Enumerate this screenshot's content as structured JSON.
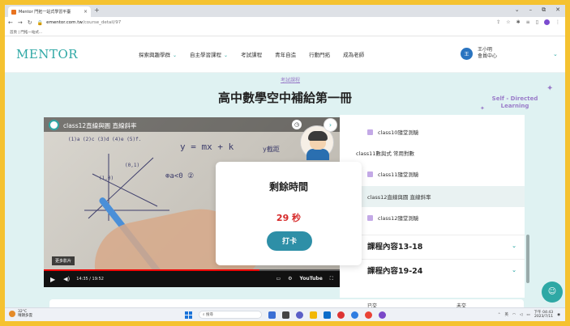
{
  "browser": {
    "tab_title": "Mentor 門拓一站式學習平臺",
    "tab_close": "×",
    "new_tab": "+",
    "url_domain": "ementor.com.tw",
    "url_path": "/course_detail/97",
    "bookmark": "首頁 | 門拓一站式...",
    "window_controls": [
      "⌄",
      "–",
      "⧉",
      "✕"
    ]
  },
  "site": {
    "logo": "MENTOR",
    "menu": [
      {
        "label": "探索興趣學群",
        "dropdown": true
      },
      {
        "label": "自主學習課程",
        "dropdown": true
      },
      {
        "label": "考試課程",
        "dropdown": false
      },
      {
        "label": "青年自造",
        "dropdown": false
      },
      {
        "label": "行動門拓",
        "dropdown": false
      },
      {
        "label": "成為老師",
        "dropdown": false
      }
    ],
    "user_avatar": "王",
    "user_name": "王小明",
    "user_center": "會員中心"
  },
  "page": {
    "category_link": "考試課程",
    "title": "高中數學空中補給第一冊",
    "badge_line1": "Self - Directed",
    "badge_line2": "Learning"
  },
  "video": {
    "title": "class12直線與圓 直線斜率",
    "more_videos": "更多影片",
    "time": "14:35 / 19:52",
    "progress_fraction": 0.73,
    "youtube": "YouTube",
    "notes": {
      "line1": "(1)a (2)c (3)d (4)e (5)f.",
      "eq": "y = mx + k",
      "eq_label": "y截距",
      "cond": "⊕a<0 ②",
      "pts": "(1,0)",
      "pts2": "(0,1)"
    }
  },
  "lessons": [
    {
      "label": "class10隨堂測驗",
      "type": "quiz",
      "active": false
    },
    {
      "label": "class11數與式 常用對數",
      "type": "video",
      "active": false
    },
    {
      "label": "class11隨堂測驗",
      "type": "quiz",
      "active": false
    },
    {
      "label": "class12直線與圓 直線斜率",
      "type": "video",
      "active": true
    },
    {
      "label": "class12隨堂測驗",
      "type": "quiz",
      "active": false
    }
  ],
  "sections": [
    {
      "label": "課程內容13-18"
    },
    {
      "label": "課程內容19-24"
    }
  ],
  "modal": {
    "title": "剩餘時間",
    "time": "29 秒",
    "button": "打卡"
  },
  "info": {
    "submitted": "已交",
    "unsubmitted": "未交"
  },
  "taskbar": {
    "temp": "32°C",
    "weather": "晴朗多雲",
    "search": "搜尋",
    "lang": "英",
    "time": "下午 04:43",
    "date": "2023/7/11"
  },
  "colors": {
    "accent": "#2ea8a5",
    "highlight": "#d62828",
    "button": "#2e8fa7",
    "background": "#dff2f2"
  }
}
